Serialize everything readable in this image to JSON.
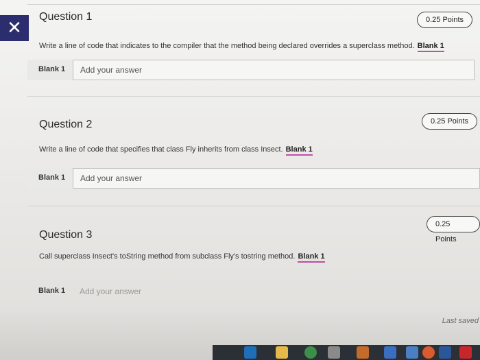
{
  "close_glyph": "✕",
  "questions": [
    {
      "title": "Question 1",
      "points": "0.25 Points",
      "prompt": "Write a line of code that indicates to the compiler that the method being declared overrides a superclass method.",
      "blank_ref": "Blank 1",
      "blank_label": "Blank 1",
      "placeholder": "Add your answer"
    },
    {
      "title": "Question 2",
      "points": "0.25 Points",
      "prompt": "Write a line of code that specifies that class Fly inherits from class Insect.",
      "blank_ref": "Blank 1",
      "blank_label": "Blank 1",
      "placeholder": "Add your answer"
    },
    {
      "title": "Question 3",
      "points": "0.25 Points",
      "prompt": "Call superclass Insect's toString method from subclass Fly's tostring method.",
      "blank_ref": "Blank 1",
      "blank_label": "Blank 1",
      "placeholder": "Add your answer"
    }
  ],
  "status": {
    "last_saved": "Last saved"
  },
  "taskbar": {
    "icons": [
      "edge-icon",
      "folder-icon",
      "chrome-icon",
      "gmail-icon",
      "app-icon",
      "store-icon",
      "mail-icon",
      "chrome-alt-icon",
      "word-icon",
      "acrobat-icon"
    ]
  }
}
